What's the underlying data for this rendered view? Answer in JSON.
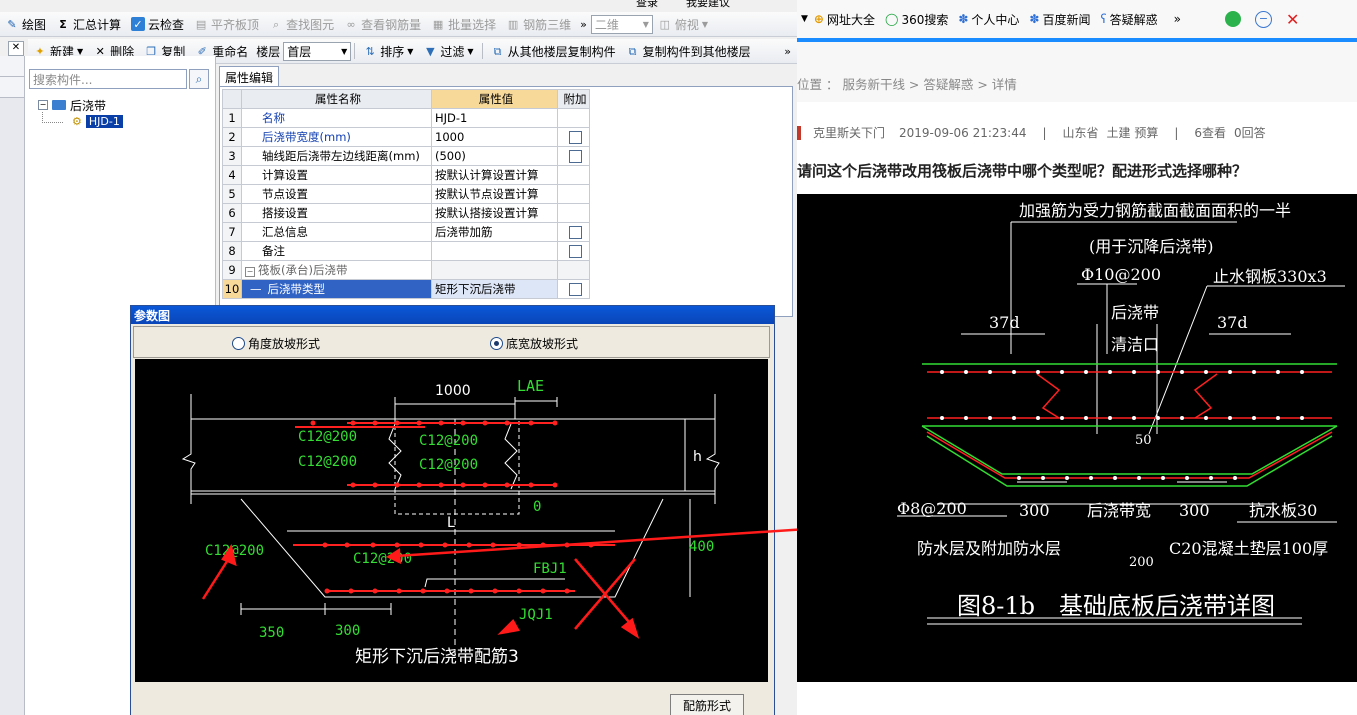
{
  "toolbar1": {
    "items": [
      {
        "label": "绘图",
        "icon": "draw-icon",
        "disabled": false
      },
      {
        "label": "汇总计算",
        "icon": "sigma-icon",
        "disabled": false
      },
      {
        "label": "云检查",
        "icon": "cloud-check-icon",
        "disabled": false
      },
      {
        "label": "平齐板顶",
        "icon": "align-top-icon",
        "disabled": true
      },
      {
        "label": "查找图元",
        "icon": "find-icon",
        "disabled": true
      },
      {
        "label": "查看钢筋量",
        "icon": "rebar-view-icon",
        "disabled": true
      },
      {
        "label": "批量选择",
        "icon": "batch-select-icon",
        "disabled": true
      },
      {
        "label": "钢筋三维",
        "icon": "rebar-3d-icon",
        "disabled": true
      }
    ],
    "view_combo": "二维",
    "view_btn": "俯视",
    "top_fragment_a": "查录",
    "top_fragment_b": "我要建议"
  },
  "toolbar2": {
    "new": "新建",
    "delete": "删除",
    "copy": "复制",
    "rename": "重命名",
    "floor_label": "楼层",
    "floor_value": "首层",
    "sort": "排序",
    "filter": "过滤",
    "copy_from": "从其他楼层复制构件",
    "copy_to": "复制构件到其他楼层"
  },
  "tree": {
    "search_placeholder": "搜索构件...",
    "root": "后浇带",
    "child": "HJD-1"
  },
  "props": {
    "tab": "属性编辑",
    "headers": [
      "属性名称",
      "属性值",
      "附加"
    ],
    "rows": [
      {
        "n": "1",
        "name": "名称",
        "value": "HJD-1",
        "blue": true,
        "check": false
      },
      {
        "n": "2",
        "name": "后浇带宽度(mm)",
        "value": "1000",
        "blue": true,
        "check": true
      },
      {
        "n": "3",
        "name": "轴线距后浇带左边线距离(mm)",
        "value": "(500)",
        "blue": false,
        "check": true
      },
      {
        "n": "4",
        "name": "计算设置",
        "value": "按默认计算设置计算",
        "blue": false,
        "check": false
      },
      {
        "n": "5",
        "name": "节点设置",
        "value": "按默认节点设置计算",
        "blue": false,
        "check": false
      },
      {
        "n": "6",
        "name": "搭接设置",
        "value": "按默认搭接设置计算",
        "blue": false,
        "check": false
      },
      {
        "n": "7",
        "name": "汇总信息",
        "value": "后浇带加筋",
        "blue": false,
        "check": true
      },
      {
        "n": "8",
        "name": "备注",
        "value": "",
        "blue": false,
        "check": true
      },
      {
        "n": "9",
        "name": "筏板(承台)后浇带",
        "value": "",
        "blue": false,
        "check": false,
        "group": true
      },
      {
        "n": "10",
        "name": "后浇带类型",
        "value": "矩形下沉后浇带",
        "blue": false,
        "check": true,
        "selected": true
      }
    ]
  },
  "dialog": {
    "title": "参数图",
    "radio1": "角度放坡形式",
    "radio2": "底宽放坡形式",
    "button": "配筋形式",
    "drawing": {
      "width_label": "1000",
      "lae": "LAE",
      "top_left_1": "C12@200",
      "top_left_2": "C12@200",
      "top_mid_1": "C12@200",
      "top_mid_2": "C12@200",
      "h": "h",
      "zero": "0",
      "L": "L",
      "bot_left": "C12@200",
      "bot_mid": "C12@200",
      "fbj": "FBJ1",
      "jqj": "JQJ1",
      "dim400": "400",
      "dim350": "350",
      "dim300": "300",
      "caption": "矩形下沉后浇带配筋3"
    }
  },
  "browser": {
    "bookmarks": [
      "网址大全",
      "360搜索",
      "个人中心",
      "百度新闻",
      "答疑解惑"
    ],
    "breadcrumb": "位置 ： 服务新干线 > 答疑解惑 > 详情",
    "author": "克里斯关下门",
    "datetime": "2019-09-06 21:23:44",
    "location": "山东省",
    "tags": "土建 预算",
    "views": "6查看",
    "answers": "0回答",
    "question": "请问这个后浇带改用筏板后浇带中哪个类型呢？配进形式选择哪种？",
    "cad": {
      "t1": "加强筋为受力钢筋截面截面面积的一半",
      "t2": "(用于沉降后浇带)",
      "t3": "Φ10@200",
      "t4": "止水钢板330x3",
      "t5": "后浇带",
      "t6": "清洁口",
      "t7": "37d",
      "t8": "37d",
      "t9": "50",
      "t10": "Φ8@200",
      "t11": "300",
      "t12": "后浇带宽",
      "t13": "300",
      "t14": "抗水板30",
      "t15": "防水层及附加防水层",
      "t16": "200",
      "t17": "C20混凝土垫层100厚",
      "t18": "图8-1b",
      "t19": "基础底板后浇带详图"
    }
  },
  "colors": {
    "cad_green": "#33dd33",
    "cad_red": "#ff2020",
    "title_blue": "#0a50cc"
  }
}
